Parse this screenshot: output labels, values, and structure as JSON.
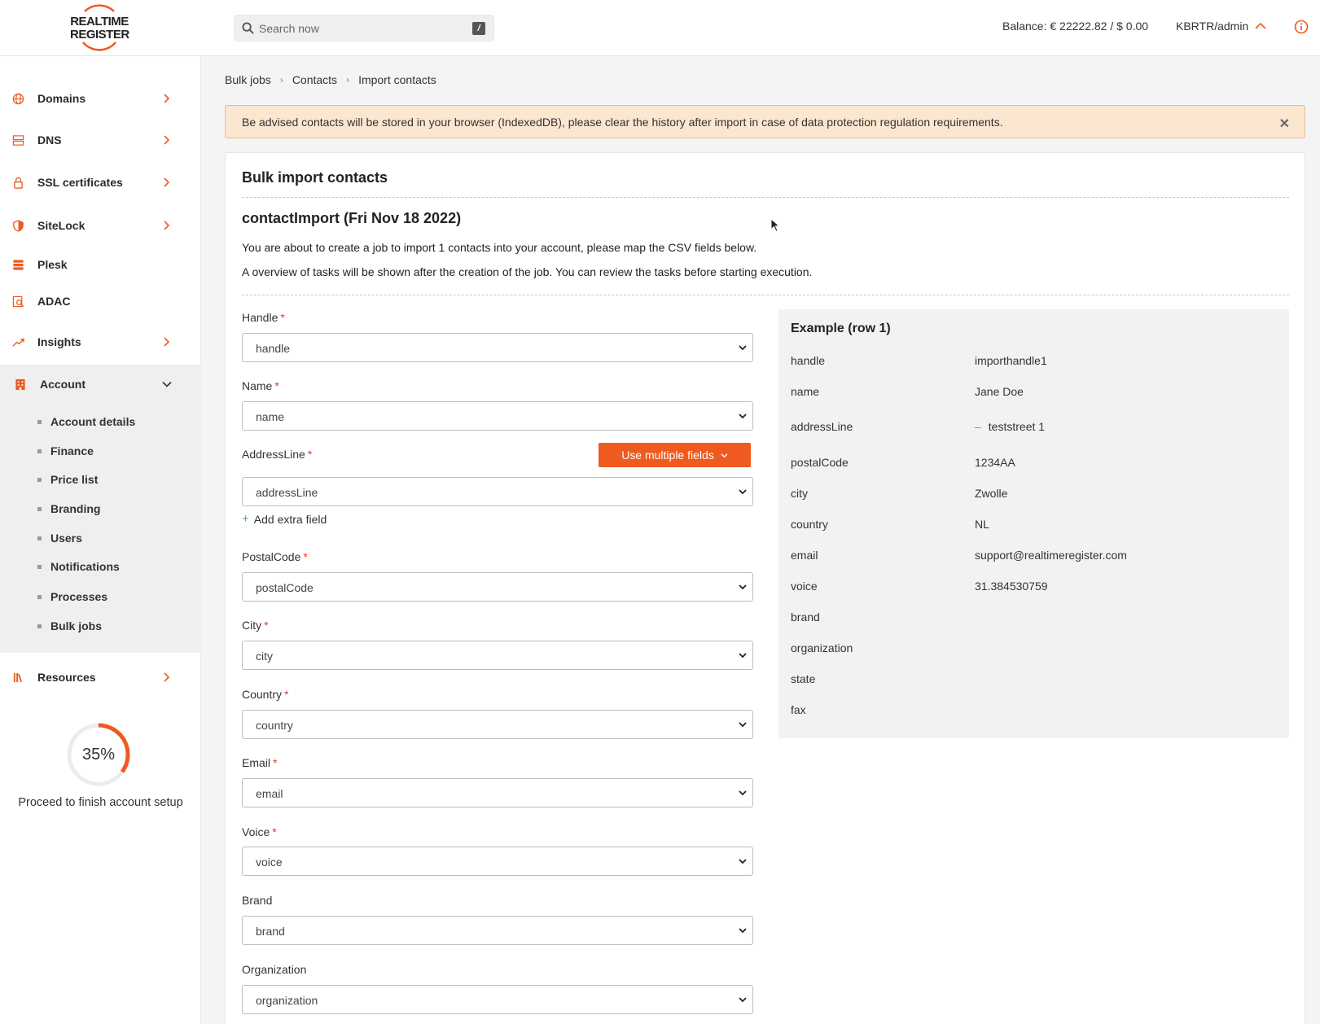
{
  "header": {
    "logo_line1": "REALTIME",
    "logo_line2": "REGISTER",
    "search_placeholder": "Search now",
    "search_shortcut": "/",
    "balance": "Balance: € 22222.82 / $ 0.00",
    "user": "KBRTR/admin"
  },
  "sidebar": {
    "items": [
      {
        "label": "Domains",
        "icon": "globe-icon"
      },
      {
        "label": "DNS",
        "icon": "server-icon"
      },
      {
        "label": "SSL certificates",
        "icon": "lock-icon"
      },
      {
        "label": "SiteLock",
        "icon": "shield-icon"
      },
      {
        "label": "Plesk",
        "icon": "stack-icon"
      },
      {
        "label": "ADAC",
        "icon": "search-doc-icon"
      },
      {
        "label": "Insights",
        "icon": "trend-icon"
      },
      {
        "label": "Account",
        "icon": "building-icon"
      },
      {
        "label": "Resources",
        "icon": "books-icon"
      }
    ],
    "account_sub": [
      "Account details",
      "Finance",
      "Price list",
      "Branding",
      "Users",
      "Notifications",
      "Processes",
      "Bulk jobs"
    ],
    "progress_label": "35%",
    "progress_value": 0.35,
    "setup_text": "Proceed to finish account setup"
  },
  "breadcrumb": [
    "Bulk jobs",
    "Contacts",
    "Import contacts"
  ],
  "alert": "Be advised contacts will be stored in your browser (IndexedDB), please clear the history after import in case of data protection regulation requirements.",
  "card": {
    "title": "Bulk import contacts",
    "import_title": "contactImport (Fri Nov 18 2022)",
    "p1": "You are about to create a job to import 1 contacts into your account, please map the CSV fields below.",
    "p2": "A overview of tasks will be shown after the creation of the job. You can review the tasks before starting execution."
  },
  "fields": [
    {
      "label": "Handle",
      "required": "*",
      "value": "handle"
    },
    {
      "label": "Name",
      "required": "*",
      "value": "name"
    },
    {
      "label": "AddressLine",
      "required": "*",
      "value": "addressLine"
    },
    {
      "label": "PostalCode",
      "required": "*",
      "value": "postalCode"
    },
    {
      "label": "City",
      "required": "*",
      "value": "city"
    },
    {
      "label": "Country",
      "required": "*",
      "value": "country"
    },
    {
      "label": "Email",
      "required": "*",
      "value": "email"
    },
    {
      "label": "Voice",
      "required": "*",
      "value": "voice"
    },
    {
      "label": "Brand",
      "required": "",
      "value": "brand"
    },
    {
      "label": "Organization",
      "required": "",
      "value": "organization"
    }
  ],
  "multi_button": "Use multiple fields",
  "add_extra": "Add extra field",
  "example": {
    "title": "Example (row 1)",
    "rows": [
      {
        "key": "handle",
        "value": "importhandle1"
      },
      {
        "key": "name",
        "value": "Jane Doe"
      },
      {
        "key": "addressLine",
        "value": "teststreet 1"
      },
      {
        "key": "postalCode",
        "value": "1234AA"
      },
      {
        "key": "city",
        "value": "Zwolle"
      },
      {
        "key": "country",
        "value": "NL"
      },
      {
        "key": "email",
        "value": "support@realtimeregister.com"
      },
      {
        "key": "voice",
        "value": "31.384530759"
      },
      {
        "key": "brand",
        "value": ""
      },
      {
        "key": "organization",
        "value": ""
      },
      {
        "key": "state",
        "value": ""
      },
      {
        "key": "fax",
        "value": ""
      }
    ],
    "list_marker": "–"
  },
  "colors": {
    "accent": "#ee5a1f",
    "alert_bg": "#fbe6d0",
    "required": "#e53935"
  }
}
